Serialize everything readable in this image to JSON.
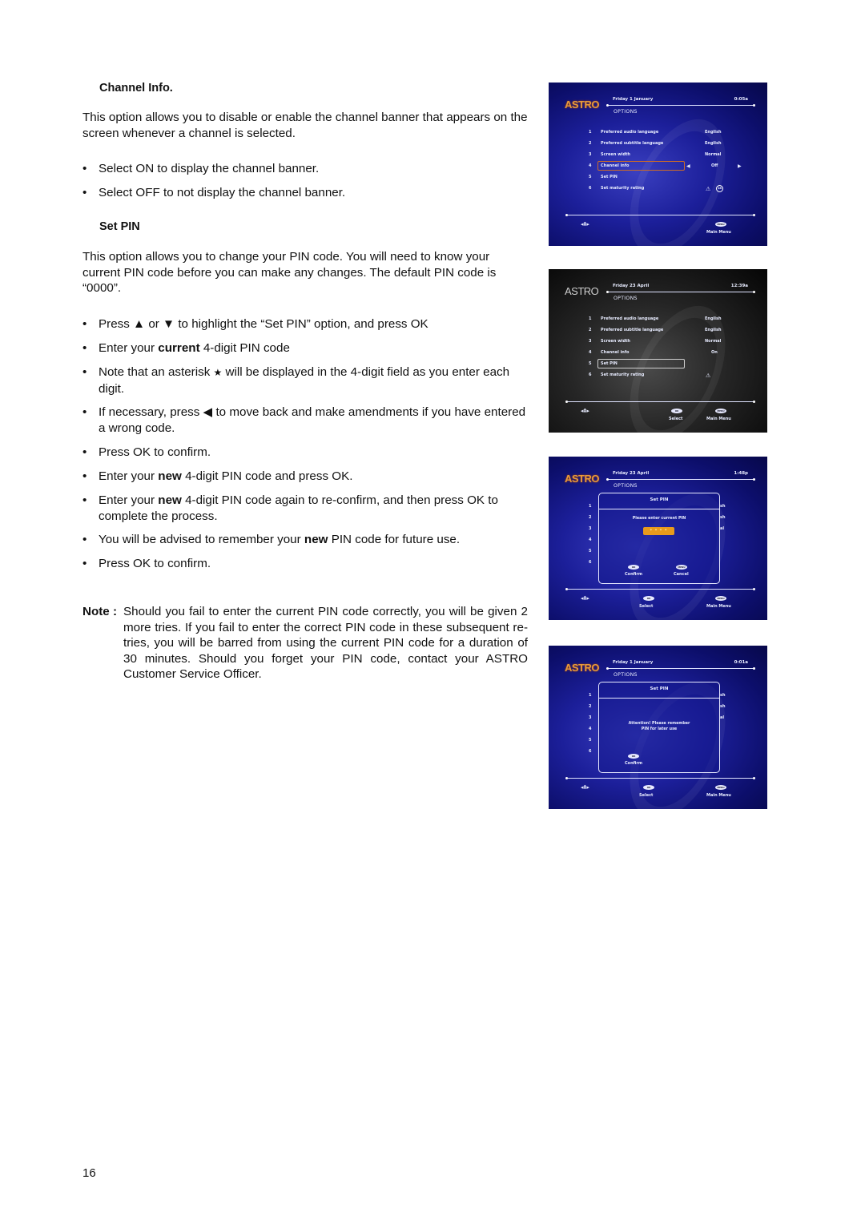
{
  "page": {
    "number": "16",
    "channel_info": {
      "heading": "Channel Info.",
      "intro": "This option allows you to disable or enable the channel banner that appears on the screen whenever a channel is selected.",
      "bullets": [
        "Select ON to display the channel banner.",
        "Select OFF to not display the channel banner."
      ]
    },
    "set_pin": {
      "heading": "Set PIN",
      "intro": "This option allows you to change your PIN code. You will need to know your current PIN code before you can make any changes.  The default PIN code is “0000”.",
      "bullets": [
        {
          "pre": "Press ",
          "icon1": "▲",
          "mid": " or ",
          "icon2": "▼",
          "post": "  to highlight the “Set PIN” option, and press OK"
        },
        {
          "pre": "Enter your ",
          "bold": "current",
          "post": " 4-digit PIN code"
        },
        {
          "pre": "Note that an asterisk  ",
          "icon1": "★",
          "post": "  will be displayed in the 4-digit field as you enter each digit."
        },
        {
          "pre": "If necessary, press ",
          "icon1": "◀",
          "post": "  to move back and make amendments if you have entered a wrong code."
        },
        {
          "pre": "Press OK to confirm."
        },
        {
          "pre": "Enter your ",
          "bold": "new",
          "post": " 4-digit PIN code and press OK."
        },
        {
          "pre": "Enter your ",
          "bold": "new",
          "post": " 4-digit PIN code again to re-confirm, and then press OK to complete the process."
        },
        {
          "pre": "You will be advised to remember your ",
          "bold": "new",
          "post": " PIN code for future use."
        },
        {
          "pre": "Press OK to confirm."
        }
      ],
      "note_label": "Note :",
      "note_text": "Should you fail to enter the current PIN code correctly, you will be given 2 more tries.  If you fail to enter the correct PIN code in these subsequent re-tries, you will be barred from using the current PIN code for a duration of 30 minutes.  Should you forget your PIN code, contact your ASTRO Customer Service Officer."
    }
  },
  "screens": [
    {
      "logo": "ASTRO",
      "date": "Friday 1 January",
      "time": "0:05a",
      "section": "OPTIONS",
      "rows": [
        {
          "num": "1",
          "label": "Preferred audio language",
          "value": "English"
        },
        {
          "num": "2",
          "label": "Preferred subtitle language",
          "value": "English"
        },
        {
          "num": "3",
          "label": "Screen width",
          "value": "Normal"
        },
        {
          "num": "4",
          "label": "Channel info",
          "value": "Off"
        },
        {
          "num": "5",
          "label": "Set PIN",
          "value": ""
        },
        {
          "num": "6",
          "label": "Set maturity rating",
          "value": ""
        }
      ],
      "rating_badge": "18",
      "footer": {
        "menu_pill": "MENU",
        "menu_label": "Main Menu"
      }
    },
    {
      "logo": "ASTRO",
      "date": "Friday 23 April",
      "time": "12:39a",
      "section": "OPTIONS",
      "rows": [
        {
          "num": "1",
          "label": "Preferred audio language",
          "value": "English"
        },
        {
          "num": "2",
          "label": "Preferred subtitle language",
          "value": "English"
        },
        {
          "num": "3",
          "label": "Screen width",
          "value": "Normal"
        },
        {
          "num": "4",
          "label": "Channel info",
          "value": "On"
        },
        {
          "num": "5",
          "label": "Set PIN",
          "value": ""
        },
        {
          "num": "6",
          "label": "Set maturity rating",
          "value": ""
        }
      ],
      "footer": {
        "ok_pill": "OK",
        "ok_label": "Select",
        "menu_pill": "MENU",
        "menu_label": "Main Menu"
      }
    },
    {
      "logo": "ASTRO",
      "date": "Friday 23 April",
      "time": "1:48p",
      "section": "OPTIONS",
      "row_nums": [
        "1",
        "2",
        "3",
        "4",
        "5",
        "6"
      ],
      "side_fragments": [
        "sh",
        "sh",
        "al"
      ],
      "dialog": {
        "title": "Set PIN",
        "message": "Please enter current PIN",
        "pin_field": "* * * *",
        "ok_pill": "OK",
        "ok_label": "Confirm",
        "menu_pill": "MENU",
        "menu_label": "Cancel"
      },
      "footer": {
        "ok_pill": "OK",
        "ok_label": "Select",
        "menu_pill": "MENU",
        "menu_label": "Main Menu"
      }
    },
    {
      "logo": "ASTRO",
      "date": "Friday 1 January",
      "time": "0:01a",
      "section": "OPTIONS",
      "row_nums": [
        "1",
        "2",
        "3",
        "4",
        "5",
        "6"
      ],
      "side_fragments": [
        "sh",
        "sh",
        "al"
      ],
      "dialog": {
        "title": "Set PIN",
        "message_line1": "Attention! Please remember",
        "message_line2": "PIN for later use",
        "ok_pill": "OK",
        "ok_label": "Confirm"
      },
      "footer": {
        "ok_pill": "OK",
        "ok_label": "Select",
        "menu_pill": "MENU",
        "menu_label": "Main Menu"
      }
    }
  ]
}
